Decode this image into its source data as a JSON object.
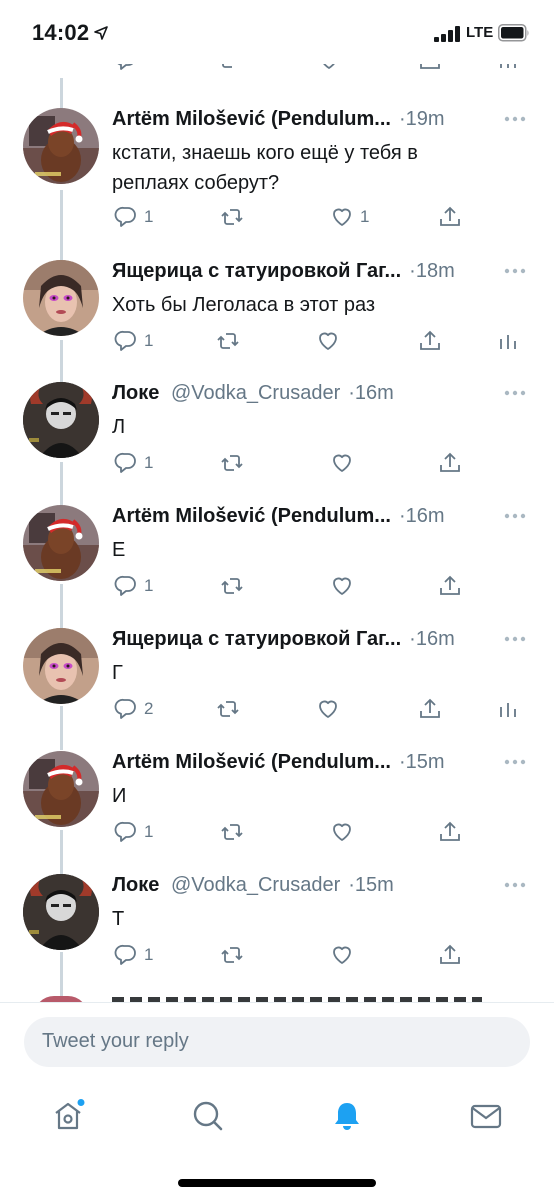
{
  "status_bar": {
    "time": "14:02",
    "network": "LTE",
    "icons": [
      "location-arrow-icon",
      "signal-bars-icon",
      "battery-icon"
    ]
  },
  "colors": {
    "text_primary": "#14171a",
    "text_secondary": "#657786",
    "accent": "#1da1f2",
    "thread_line": "#ccd6dd",
    "input_bg": "#f0f2f5"
  },
  "tweets": [
    {
      "name": "Artëm Milošević (Pendulum...",
      "handle": "",
      "time": "·19m",
      "text_lines": [
        "кстати, знаешь кого ещё у тебя в",
        "реплаях соберут?"
      ],
      "replies": "1",
      "retweets": "",
      "likes": "1",
      "has_stats": false,
      "avatar": "artem-avatar"
    },
    {
      "name": "Ящерица с татуировкой Гаг...",
      "handle": "",
      "time": "·18m",
      "text_lines": [
        "Хоть бы Леголаса в этот раз"
      ],
      "replies": "1",
      "retweets": "",
      "likes": "",
      "has_stats": true,
      "avatar": "lizard-avatar"
    },
    {
      "name": "Локе",
      "handle": "@Vodka_Crusader",
      "time": "·16m",
      "text_lines": [
        "Л"
      ],
      "replies": "1",
      "retweets": "",
      "likes": "",
      "has_stats": false,
      "avatar": "loke-avatar"
    },
    {
      "name": "Artëm Milošević (Pendulum...",
      "handle": "",
      "time": "·16m",
      "text_lines": [
        "Е"
      ],
      "replies": "1",
      "retweets": "",
      "likes": "",
      "has_stats": false,
      "avatar": "artem-avatar"
    },
    {
      "name": "Ящерица с татуировкой Гаг...",
      "handle": "",
      "time": "·16m",
      "text_lines": [
        "Г"
      ],
      "replies": "2",
      "retweets": "",
      "likes": "",
      "has_stats": true,
      "avatar": "lizard-avatar"
    },
    {
      "name": "Artëm Milošević (Pendulum...",
      "handle": "",
      "time": "·15m",
      "text_lines": [
        "И"
      ],
      "replies": "1",
      "retweets": "",
      "likes": "",
      "has_stats": false,
      "avatar": "artem-avatar"
    },
    {
      "name": "Локе",
      "handle": "@Vodka_Crusader",
      "time": "·15m",
      "text_lines": [
        "Т"
      ],
      "replies": "1",
      "retweets": "",
      "likes": "",
      "has_stats": false,
      "avatar": "loke-avatar"
    }
  ],
  "reply_box": {
    "placeholder": "Tweet your reply"
  },
  "tab_bar": {
    "items": [
      "home-icon",
      "search-icon",
      "notifications-icon",
      "messages-icon"
    ],
    "active": "notifications-icon"
  }
}
